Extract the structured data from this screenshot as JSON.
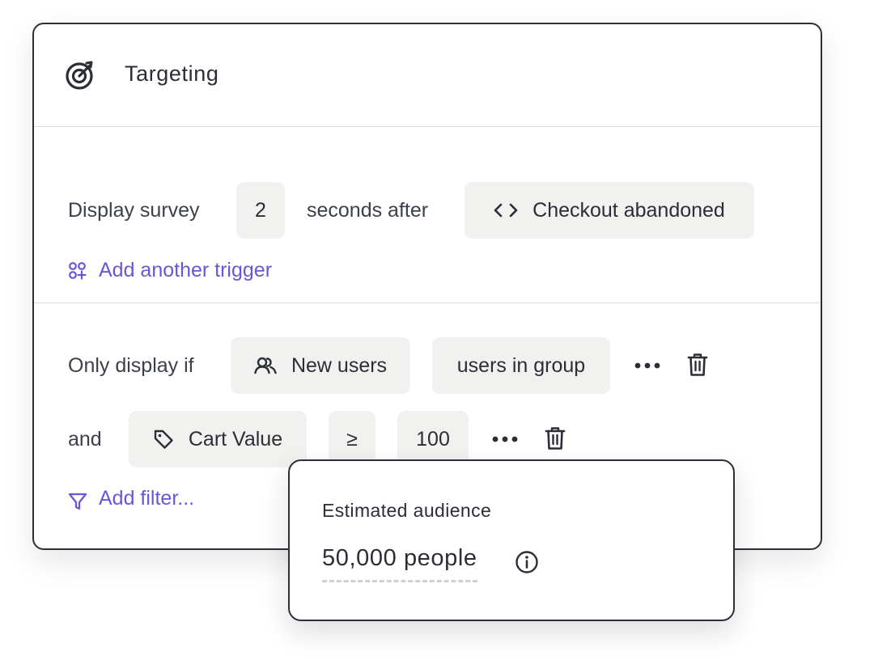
{
  "panel": {
    "title": "Targeting",
    "title_icon": "target-icon"
  },
  "trigger": {
    "prefix": "Display survey",
    "seconds_value": "2",
    "middle": "seconds after",
    "event_icon": "code-icon",
    "event_label": "Checkout abandoned",
    "add_trigger_icon": "add-trigger-icon",
    "add_trigger_label": "Add another trigger"
  },
  "filters": {
    "prefix": "Only display if",
    "group_icon": "users-icon",
    "group_label": "New users",
    "group_operator": "users in group",
    "and_label": "and",
    "property_icon": "tag-icon",
    "property_label": "Cart Value",
    "comparator": "≥",
    "value": "100",
    "add_filter_icon": "filter-icon",
    "add_filter_label": "Add filter..."
  },
  "audience": {
    "title": "Estimated audience",
    "value": "50,000 people",
    "info_icon": "info-icon"
  },
  "colors": {
    "accent": "#6b55d8",
    "chip_bg": "#f1f1f0",
    "border": "#2c3039",
    "divider": "#dcdde1"
  }
}
